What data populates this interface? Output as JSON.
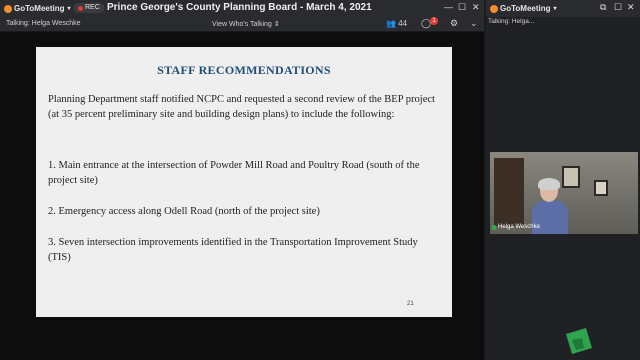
{
  "app": {
    "name": "GoToMeeting",
    "window_title": "Prince George's County Planning Board - March 4, 2021",
    "rec_label": "REC"
  },
  "subbar": {
    "talking": "Talking: Helga Weschke",
    "view_label": "View Who's Talking",
    "attendee_count": "44",
    "chat_badge": "1"
  },
  "slide": {
    "title": "STAFF RECOMMENDATIONS",
    "intro": "Planning Department staff notified NCPC and requested a second review of the BEP project (at 35 percent preliminary site and building design plans) to include the following:",
    "items": [
      "1.  Main entrance at the intersection of Powder Mill Road and Poultry Road (south of the project site)",
      "2.  Emergency access along Odell Road (north of the project site)",
      "3.  Seven intersection improvements identified in the Transportation Improvement Study (TIS)"
    ],
    "page_number": "21"
  },
  "side": {
    "app_name": "GoToMeeting",
    "talking": "Talking: Helga...",
    "video_name": "Helga Weschke"
  },
  "colors": {
    "brand_orange": "#f68d2e",
    "rec_red": "#e53935",
    "slide_title_blue": "#1f4e79",
    "mic_green": "#2ab04a"
  },
  "icons": [
    "goto-logo-icon",
    "record-dot-icon",
    "people-icon",
    "chat-icon",
    "gear-icon",
    "chevron-down-icon",
    "minimize-icon",
    "restore-icon",
    "close-icon",
    "mic-icon"
  ]
}
